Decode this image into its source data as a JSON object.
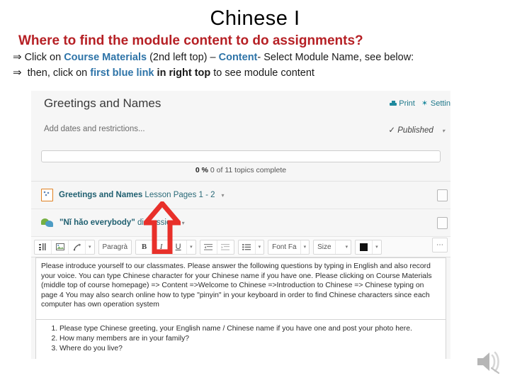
{
  "slide": {
    "title": "Chinese I",
    "subtitle": "Where to find the module content to do assignments?",
    "bullets": [
      {
        "glyph": "⇒",
        "seg1": "Click on ",
        "link1": "Course Materials",
        "seg2": " (2nd left top) – ",
        "link2": "Content",
        "seg3": "- Select Module Name, see below:"
      },
      {
        "glyph": "⇒",
        "seg1": " then, click on ",
        "link1": "first blue link",
        "seg2": " in right top",
        "seg3": " to see module content"
      }
    ]
  },
  "screenshot": {
    "module_title": "Greetings and Names",
    "actions": [
      {
        "label": "Print",
        "icon": "printer-icon"
      },
      {
        "label": "Settin",
        "icon": "gear-icon"
      }
    ],
    "dates_link": "Add dates and restrictions...",
    "published_label": "Published",
    "published_check": "✓",
    "progress": {
      "percent_label": "0 %",
      "detail": "0 of 11 topics complete",
      "value": 0
    },
    "items": [
      {
        "icon": "document-icon",
        "label_bold": "Greetings and Names",
        "label_light": " Lesson Pages 1 - 2",
        "caret": "▾"
      },
      {
        "icon": "discussion-bubble-icon",
        "label_bold": "\"Nǐ hǎo everybody\"",
        "label_light": " discussion",
        "caret": "▾"
      }
    ],
    "toolbar": {
      "groups": [
        {
          "buttons": [
            "insert-stuff-icon",
            "image-icon",
            "quicklink-icon",
            "caret"
          ]
        },
        {
          "buttons": [
            "Paragrà",
            "caret-para"
          ]
        },
        {
          "buttons": [
            "B",
            "I",
            "U",
            "caret-format"
          ]
        },
        {
          "buttons": [
            "indent-decrease-icon",
            "indent-increase-icon"
          ]
        },
        {
          "buttons": [
            "bullet-list-icon",
            "caret-list"
          ]
        },
        {
          "buttons": [
            "Font Fa",
            "caret-font"
          ]
        },
        {
          "buttons": [
            "Size",
            "caret-size"
          ]
        },
        {
          "buttons": [
            "color-swatch",
            "caret-color"
          ]
        }
      ],
      "font_family_label": "Font Fa",
      "size_label": "Size",
      "paragraph_label": "Paragrà",
      "bold_label": "B",
      "italic_label": "I",
      "underline_label": "U",
      "overflow_label": "⋯",
      "color_swatch": "#111111"
    },
    "editor_text": "Please introduce yourself to our classmates. Please answer the following questions by typing in English and also record your voice.   You can type Chinese character for your Chinese name if you have one.  Please clicking on Course Materials (middle top of course homepage) => Content =>Welcome to Chinese =>Introduction to Chinese => Chinese typing on page 4 You may also search online how to type \"pinyin\" in your keyboard in order to find Chinese characters since each computer has own operation system",
    "editor_list": [
      "Please type Chinese greeting, your English name / Chinese name if you have one and post your photo here.",
      "How many members are in your family?",
      "Where do you live?"
    ]
  },
  "annotations": {
    "arrow_color": "#E8302A",
    "arrow_name": "red-up-arrow-annotation"
  },
  "colors": {
    "heading_red": "#B62025",
    "link_blue": "#2E74A8",
    "link_teal": "#1F5F70",
    "action_teal": "#217A8C"
  },
  "speaker": {
    "icon": "speaker-muted-icon"
  }
}
